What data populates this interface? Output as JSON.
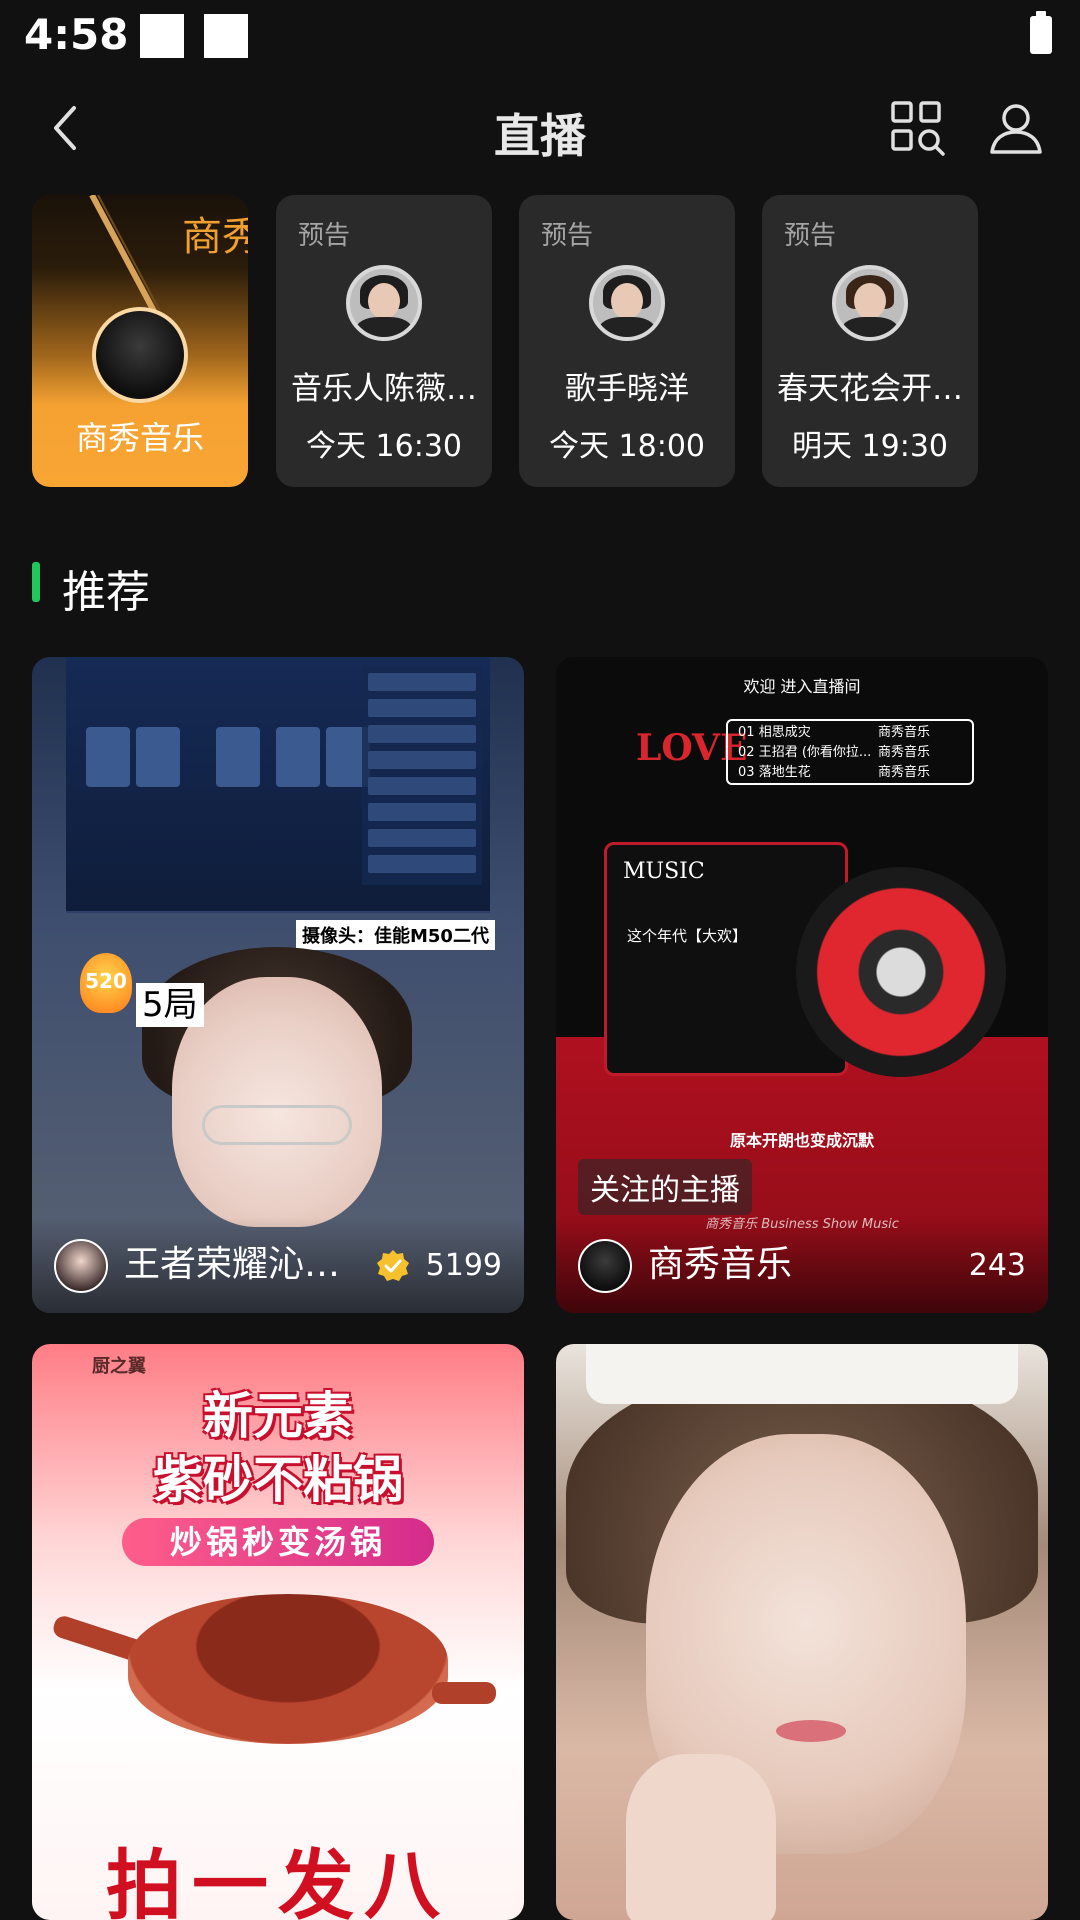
{
  "status_bar": {
    "time": "4:58"
  },
  "header": {
    "title": "直播"
  },
  "featured": {
    "name": "商秀音乐",
    "brand_art_text": "商秀音乐"
  },
  "previews": [
    {
      "tag": "预告",
      "title": "音乐人陈薇…",
      "time": "今天 16:30"
    },
    {
      "tag": "预告",
      "title": "歌手晓洋",
      "time": "今天 18:00"
    },
    {
      "tag": "预告",
      "title": "春天花会开…",
      "time": "明天 19:30"
    }
  ],
  "section": {
    "title": "推荐"
  },
  "streams": [
    {
      "name": "王者荣耀沁…",
      "viewers": "5199",
      "verified": true,
      "overlay": {
        "badge": "520",
        "round": "5局",
        "camera": "摄像头：佳能M50二代"
      }
    },
    {
      "name": "商秀音乐",
      "viewers": "243",
      "overlay": {
        "welcome": "欢迎 进入直播间",
        "love": "LOVE",
        "songs": [
          {
            "no": "01",
            "title": "相思成灾",
            "artist": "商秀音乐"
          },
          {
            "no": "02",
            "title": "王招君 (你看你拉...",
            "artist": "商秀音乐"
          },
          {
            "no": "03",
            "title": "落地生花",
            "artist": "商秀音乐"
          }
        ],
        "music_word": "MUSIC",
        "era": "这个年代【大欢】",
        "lyric": "原本开朗也变成沉默",
        "follow_label": "关注的主播",
        "caption": "商秀音乐 Business Show Music"
      }
    },
    {
      "overlay": {
        "brand": "厨之翼",
        "line1": "新元素",
        "line2": "紫砂不粘锅",
        "pill": "炒锅秒变汤锅",
        "slogan": "拍一发八"
      }
    },
    {}
  ],
  "colors": {
    "background": "#111111",
    "accent_green": "#22c75c",
    "featured_orange": "#f8a534",
    "card_bg": "#2a2a2a"
  }
}
